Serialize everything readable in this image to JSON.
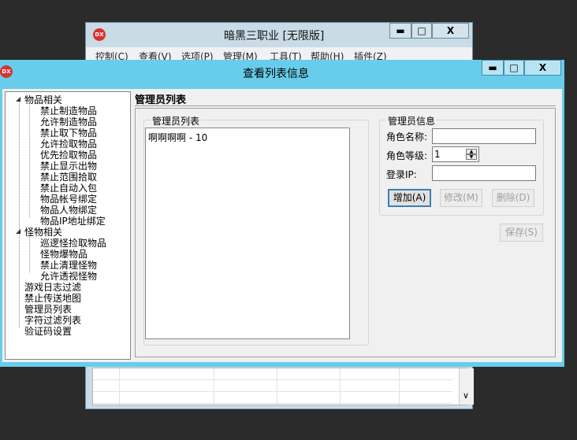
{
  "bg_window": {
    "title": "暗黑三职业 [无限版]",
    "logo": "DX",
    "controls": {
      "minimize": "▬",
      "maximize": "□",
      "close": "X"
    },
    "menu": [
      "控制(C)",
      "查看(V)",
      "选项(P)",
      "管理(M)",
      "工具(T)",
      "帮助(H)",
      "插件(Z)"
    ],
    "scroll_down_icon": "∨"
  },
  "dialog": {
    "title": "查看列表信息",
    "logo": "DX",
    "controls": {
      "minimize": "▬",
      "maximize": "□",
      "close": "X"
    }
  },
  "tree": {
    "expand_glyph": "◢",
    "groups": [
      {
        "label": "物品相关",
        "children": [
          "禁止制造物品",
          "允许制造物品",
          "禁止取下物品",
          "允许捡取物品",
          "优先捡取物品",
          "禁止显示出物",
          "禁止范围拾取",
          "禁止自动入包",
          "物品帐号绑定",
          "物品人物绑定",
          "物品IP地址绑定"
        ]
      },
      {
        "label": "怪物相关",
        "children": [
          "巡逻怪捡取物品",
          "怪物爆物品",
          "禁止清理怪物",
          "允许透视怪物"
        ]
      }
    ],
    "top_items": [
      "游戏日志过滤",
      "禁止传送地图",
      "管理员列表",
      "字符过滤列表",
      "验证码设置"
    ]
  },
  "panel": {
    "heading": "管理员列表",
    "list_group_title": "管理员列表",
    "list_items": [
      "啊啊啊啊 - 10"
    ],
    "info_group_title": "管理员信息",
    "fields": {
      "role_name_label": "角色名称:",
      "role_name_value": "",
      "role_level_label": "角色等级:",
      "role_level_value": "1",
      "login_ip_label": "登录IP:",
      "login_ip_value": ""
    },
    "spin_up": "▲",
    "spin_down": "▼",
    "buttons": {
      "add": "增加(A)",
      "edit": "修改(M)",
      "delete": "删除(D)",
      "save": "保存(S)"
    }
  }
}
